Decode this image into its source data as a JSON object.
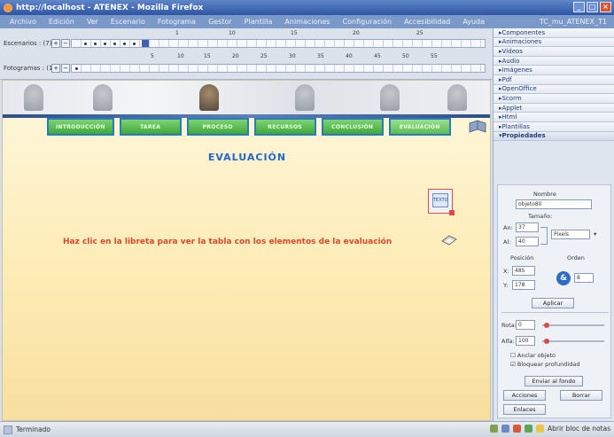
{
  "window": {
    "title": "http://localhost - ATENEX - Mozilla Firefox"
  },
  "menu": [
    "Archivo",
    "Edición",
    "Ver",
    "Escenario",
    "Fotograma",
    "Gestor",
    "Plantilla",
    "Animaciones",
    "Configuración",
    "Accesibilidad",
    "Ayuda"
  ],
  "menu_right": "TC_mu_ATENEX_T1",
  "timeline": {
    "escenarios_label": "Escenarios : (7)",
    "fotogramas_label": "Fotogramas : (1)",
    "ruler_top": [
      "1",
      "10",
      "15",
      "20",
      "25"
    ],
    "ruler_bottom": [
      "5",
      "10",
      "15",
      "20",
      "25",
      "30",
      "35",
      "40",
      "45",
      "50",
      "55"
    ]
  },
  "stage": {
    "nav": [
      "INTRODUCCIÓN",
      "TAREA",
      "PROCESO",
      "RECURSOS",
      "CONCLUSIÓN",
      "EVALUACIÓN"
    ],
    "title": "EVALUACIÓN",
    "object_caption": "TEXTO",
    "instruction": "Haz clic en la libreta para ver la tabla con los elementos de la evaluación"
  },
  "panel": {
    "sections": [
      "Componentes",
      "Animaciones",
      "Vídeos",
      "Audio",
      "Imágenes",
      "Pdf",
      "OpenOffice",
      "Scorm",
      "Applet",
      "Html",
      "Plantillas",
      "Propiedades"
    ],
    "props": {
      "nombre_label": "Nombre",
      "nombre_value": "objeto80",
      "tamano_label": "Tamaño:",
      "an_label": "An:",
      "an_value": "37",
      "al_label": "Al:",
      "al_value": "40",
      "unit_value": "Pixels",
      "posicion_label": "Posición",
      "orden_label": "Orden",
      "x_label": "X:",
      "x_value": "485",
      "y_label": "Y:",
      "y_value": "178",
      "orden_value": "8",
      "aplicar": "Aplicar",
      "rota_label": "Rota:",
      "rota_value": "0",
      "alfa_label": "Alfa:",
      "alfa_value": "100",
      "anclar": "Anclar objeto",
      "bloquear": "Bloquear profundidad",
      "enviar": "Enviar al fondo",
      "acciones": "Acciones",
      "borrar": "Borrar",
      "enlaces": "Enlaces"
    }
  },
  "status": {
    "text": "Terminado",
    "tray_text": "Abrir bloc de notas"
  }
}
